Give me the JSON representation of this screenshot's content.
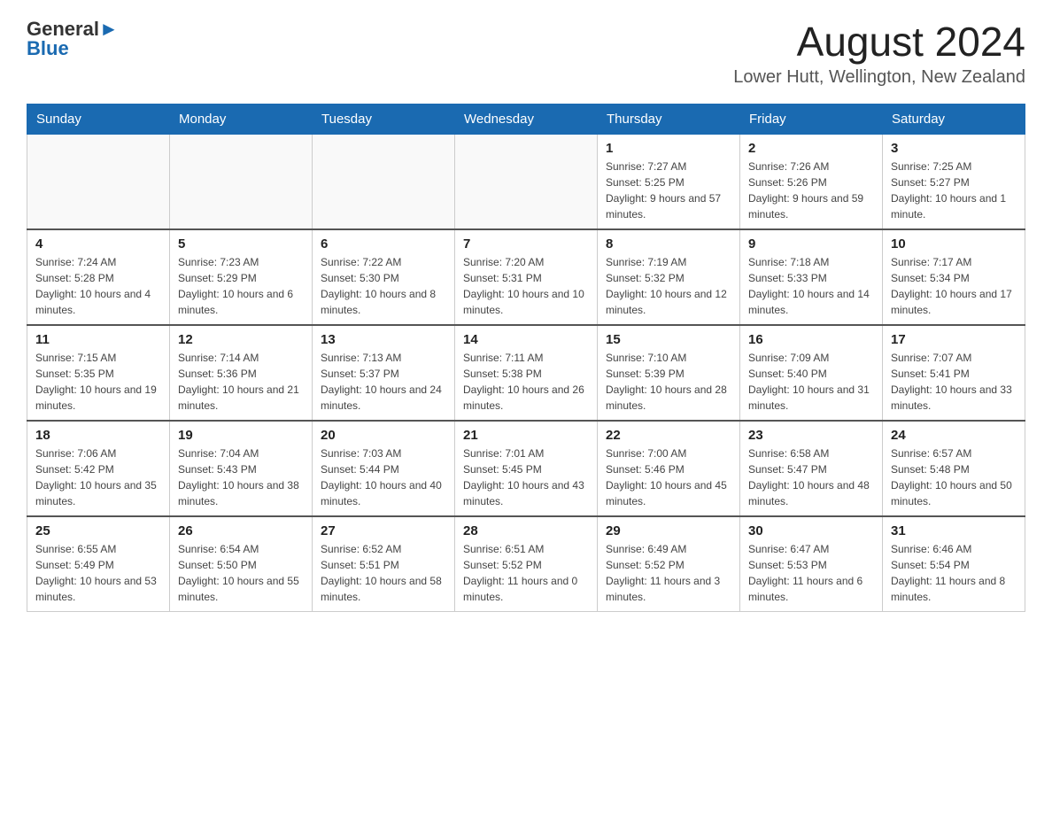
{
  "header": {
    "logo_general": "General",
    "logo_blue": "Blue",
    "month_title": "August 2024",
    "location": "Lower Hutt, Wellington, New Zealand"
  },
  "days_of_week": [
    "Sunday",
    "Monday",
    "Tuesday",
    "Wednesday",
    "Thursday",
    "Friday",
    "Saturday"
  ],
  "weeks": [
    {
      "days": [
        {
          "num": "",
          "info": ""
        },
        {
          "num": "",
          "info": ""
        },
        {
          "num": "",
          "info": ""
        },
        {
          "num": "",
          "info": ""
        },
        {
          "num": "1",
          "info": "Sunrise: 7:27 AM\nSunset: 5:25 PM\nDaylight: 9 hours and 57 minutes."
        },
        {
          "num": "2",
          "info": "Sunrise: 7:26 AM\nSunset: 5:26 PM\nDaylight: 9 hours and 59 minutes."
        },
        {
          "num": "3",
          "info": "Sunrise: 7:25 AM\nSunset: 5:27 PM\nDaylight: 10 hours and 1 minute."
        }
      ]
    },
    {
      "days": [
        {
          "num": "4",
          "info": "Sunrise: 7:24 AM\nSunset: 5:28 PM\nDaylight: 10 hours and 4 minutes."
        },
        {
          "num": "5",
          "info": "Sunrise: 7:23 AM\nSunset: 5:29 PM\nDaylight: 10 hours and 6 minutes."
        },
        {
          "num": "6",
          "info": "Sunrise: 7:22 AM\nSunset: 5:30 PM\nDaylight: 10 hours and 8 minutes."
        },
        {
          "num": "7",
          "info": "Sunrise: 7:20 AM\nSunset: 5:31 PM\nDaylight: 10 hours and 10 minutes."
        },
        {
          "num": "8",
          "info": "Sunrise: 7:19 AM\nSunset: 5:32 PM\nDaylight: 10 hours and 12 minutes."
        },
        {
          "num": "9",
          "info": "Sunrise: 7:18 AM\nSunset: 5:33 PM\nDaylight: 10 hours and 14 minutes."
        },
        {
          "num": "10",
          "info": "Sunrise: 7:17 AM\nSunset: 5:34 PM\nDaylight: 10 hours and 17 minutes."
        }
      ]
    },
    {
      "days": [
        {
          "num": "11",
          "info": "Sunrise: 7:15 AM\nSunset: 5:35 PM\nDaylight: 10 hours and 19 minutes."
        },
        {
          "num": "12",
          "info": "Sunrise: 7:14 AM\nSunset: 5:36 PM\nDaylight: 10 hours and 21 minutes."
        },
        {
          "num": "13",
          "info": "Sunrise: 7:13 AM\nSunset: 5:37 PM\nDaylight: 10 hours and 24 minutes."
        },
        {
          "num": "14",
          "info": "Sunrise: 7:11 AM\nSunset: 5:38 PM\nDaylight: 10 hours and 26 minutes."
        },
        {
          "num": "15",
          "info": "Sunrise: 7:10 AM\nSunset: 5:39 PM\nDaylight: 10 hours and 28 minutes."
        },
        {
          "num": "16",
          "info": "Sunrise: 7:09 AM\nSunset: 5:40 PM\nDaylight: 10 hours and 31 minutes."
        },
        {
          "num": "17",
          "info": "Sunrise: 7:07 AM\nSunset: 5:41 PM\nDaylight: 10 hours and 33 minutes."
        }
      ]
    },
    {
      "days": [
        {
          "num": "18",
          "info": "Sunrise: 7:06 AM\nSunset: 5:42 PM\nDaylight: 10 hours and 35 minutes."
        },
        {
          "num": "19",
          "info": "Sunrise: 7:04 AM\nSunset: 5:43 PM\nDaylight: 10 hours and 38 minutes."
        },
        {
          "num": "20",
          "info": "Sunrise: 7:03 AM\nSunset: 5:44 PM\nDaylight: 10 hours and 40 minutes."
        },
        {
          "num": "21",
          "info": "Sunrise: 7:01 AM\nSunset: 5:45 PM\nDaylight: 10 hours and 43 minutes."
        },
        {
          "num": "22",
          "info": "Sunrise: 7:00 AM\nSunset: 5:46 PM\nDaylight: 10 hours and 45 minutes."
        },
        {
          "num": "23",
          "info": "Sunrise: 6:58 AM\nSunset: 5:47 PM\nDaylight: 10 hours and 48 minutes."
        },
        {
          "num": "24",
          "info": "Sunrise: 6:57 AM\nSunset: 5:48 PM\nDaylight: 10 hours and 50 minutes."
        }
      ]
    },
    {
      "days": [
        {
          "num": "25",
          "info": "Sunrise: 6:55 AM\nSunset: 5:49 PM\nDaylight: 10 hours and 53 minutes."
        },
        {
          "num": "26",
          "info": "Sunrise: 6:54 AM\nSunset: 5:50 PM\nDaylight: 10 hours and 55 minutes."
        },
        {
          "num": "27",
          "info": "Sunrise: 6:52 AM\nSunset: 5:51 PM\nDaylight: 10 hours and 58 minutes."
        },
        {
          "num": "28",
          "info": "Sunrise: 6:51 AM\nSunset: 5:52 PM\nDaylight: 11 hours and 0 minutes."
        },
        {
          "num": "29",
          "info": "Sunrise: 6:49 AM\nSunset: 5:52 PM\nDaylight: 11 hours and 3 minutes."
        },
        {
          "num": "30",
          "info": "Sunrise: 6:47 AM\nSunset: 5:53 PM\nDaylight: 11 hours and 6 minutes."
        },
        {
          "num": "31",
          "info": "Sunrise: 6:46 AM\nSunset: 5:54 PM\nDaylight: 11 hours and 8 minutes."
        }
      ]
    }
  ]
}
